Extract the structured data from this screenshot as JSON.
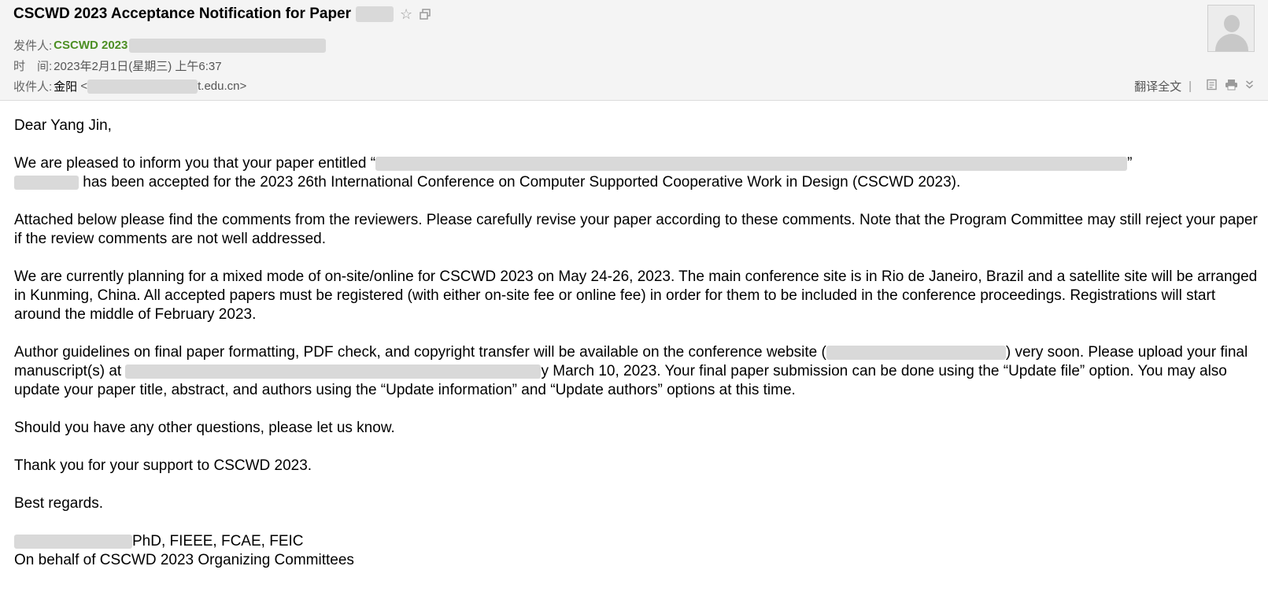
{
  "email": {
    "subject": "CSCWD 2023 Acceptance Notification for Paper",
    "from_label": "发件人:",
    "from_name": "CSCWD 2023",
    "time_label": "时　间:",
    "time_value": "2023年2月1日(星期三) 上午6:37",
    "to_label": "收件人:",
    "to_name": "金阳",
    "to_open": " <",
    "to_email_tail": "t.edu.cn>"
  },
  "toolbar": {
    "translate": "翻译全文",
    "separator": "|"
  },
  "icons": [
    "star-icon",
    "new-window-icon",
    "avatar-icon",
    "note-icon",
    "print-icon",
    "expand-icon"
  ],
  "colors": {
    "header_bg": "#f4f4f4",
    "sender_green": "#4d8f24",
    "meta_gray": "#555555",
    "redaction": "#d9d9d9"
  },
  "body": {
    "greeting": "Dear Yang Jin,",
    "p1_a": "We are pleased to inform you that your paper entitled “",
    "p1_b": "”",
    "p1_c": " has been accepted for the 2023 26th International Conference on Computer Supported Cooperative Work in Design (CSCWD 2023).",
    "p2": "Attached below please find the comments from the reviewers. Please carefully revise your paper according to these comments. Note that the Program Committee may still reject your paper if the review comments are not well addressed.",
    "p3": "We are currently planning for a mixed mode of on-site/online for CSCWD 2023 on May 24-26, 2023. The main conference site is in Rio de Janeiro, Brazil and a satellite site will be arranged in Kunming, China. All accepted papers must be registered (with either on-site fee or online fee) in order for them to be included in the conference proceedings. Registrations will start around the middle of February 2023.",
    "p4_a": "Author guidelines on final paper formatting, PDF check, and copyright transfer will be available on the conference website (",
    "p4_b": ") very soon. Please upload your final manuscript(s) at ",
    "p4_c": "y March 10, 2023. Your final paper submission can be done using the “Update file” option. You may also update your paper title, abstract, and authors using the “Update information” and “Update authors” options at this time.",
    "p5": "Should you have any other questions, please let us know.",
    "p6": "Thank you for your support to CSCWD 2023.",
    "p7": "Best regards.",
    "sig_credentials": "PhD, FIEEE, FCAE, FEIC",
    "sig_line2": "On behalf of CSCWD 2023 Organizing Committees"
  }
}
